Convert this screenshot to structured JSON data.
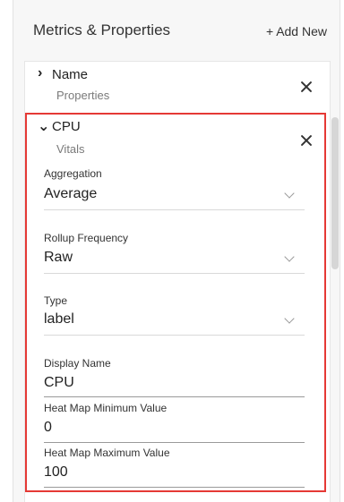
{
  "header": {
    "title": "Metrics & Properties",
    "add_new_plus": "+",
    "add_new_label": "Add New"
  },
  "items": {
    "name": {
      "chevron": "›",
      "title": "Name",
      "subtitle": "Properties",
      "expanded": false
    },
    "cpu": {
      "chevron": "⌄",
      "title": "CPU",
      "subtitle": "Vitals",
      "expanded": true
    }
  },
  "fields": {
    "aggregation": {
      "label": "Aggregation",
      "value": "Average"
    },
    "rollup": {
      "label": "Rollup Frequency",
      "value": "Raw"
    },
    "type": {
      "label": "Type",
      "value": "label"
    },
    "display_name": {
      "label": "Display Name",
      "value": "CPU"
    },
    "heat_min": {
      "label": "Heat Map Minimum Value",
      "value": "0"
    },
    "heat_max": {
      "label": "Heat Map Maximum Value",
      "value": "100"
    }
  },
  "colors": {
    "highlight": "#e53935",
    "background": "#f7f7f7",
    "panel": "#ffffff"
  }
}
